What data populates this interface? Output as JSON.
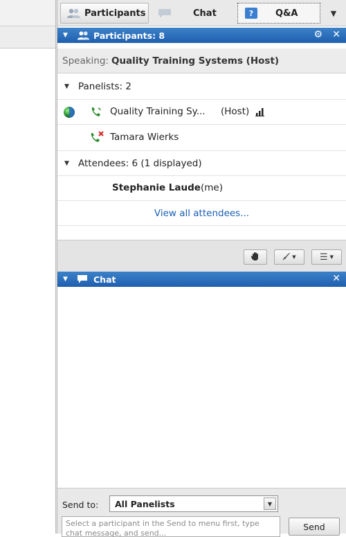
{
  "tabs": {
    "participants": "Participants",
    "chat": "Chat",
    "qa": "Q&A"
  },
  "participants_panel": {
    "title": "Participants: 8",
    "speaking_label": "Speaking:",
    "speaking_value": "Quality Training Systems (Host)",
    "panelists_header": "Panelists: 2",
    "panelists": [
      {
        "name": "Quality Training Sy...",
        "role": "(Host)"
      },
      {
        "name": "Tamara Wierks"
      }
    ],
    "attendees_header": "Attendees: 6 (1 displayed)",
    "attendee": {
      "name": "Stephanie Laude",
      "suffix": "(me)"
    },
    "view_all": "View all attendees..."
  },
  "chat_panel": {
    "title": "Chat",
    "send_to_label": "Send to:",
    "send_to_value": "All Panelists",
    "message_placeholder": "Select a participant in the Send to menu first, type chat message, and send...",
    "send_label": "Send"
  },
  "colors": {
    "header_blue": "#2a6dba",
    "link_blue": "#1a5fb4",
    "hangup_red": "#d42020",
    "phone_green": "#2e8b2e"
  }
}
